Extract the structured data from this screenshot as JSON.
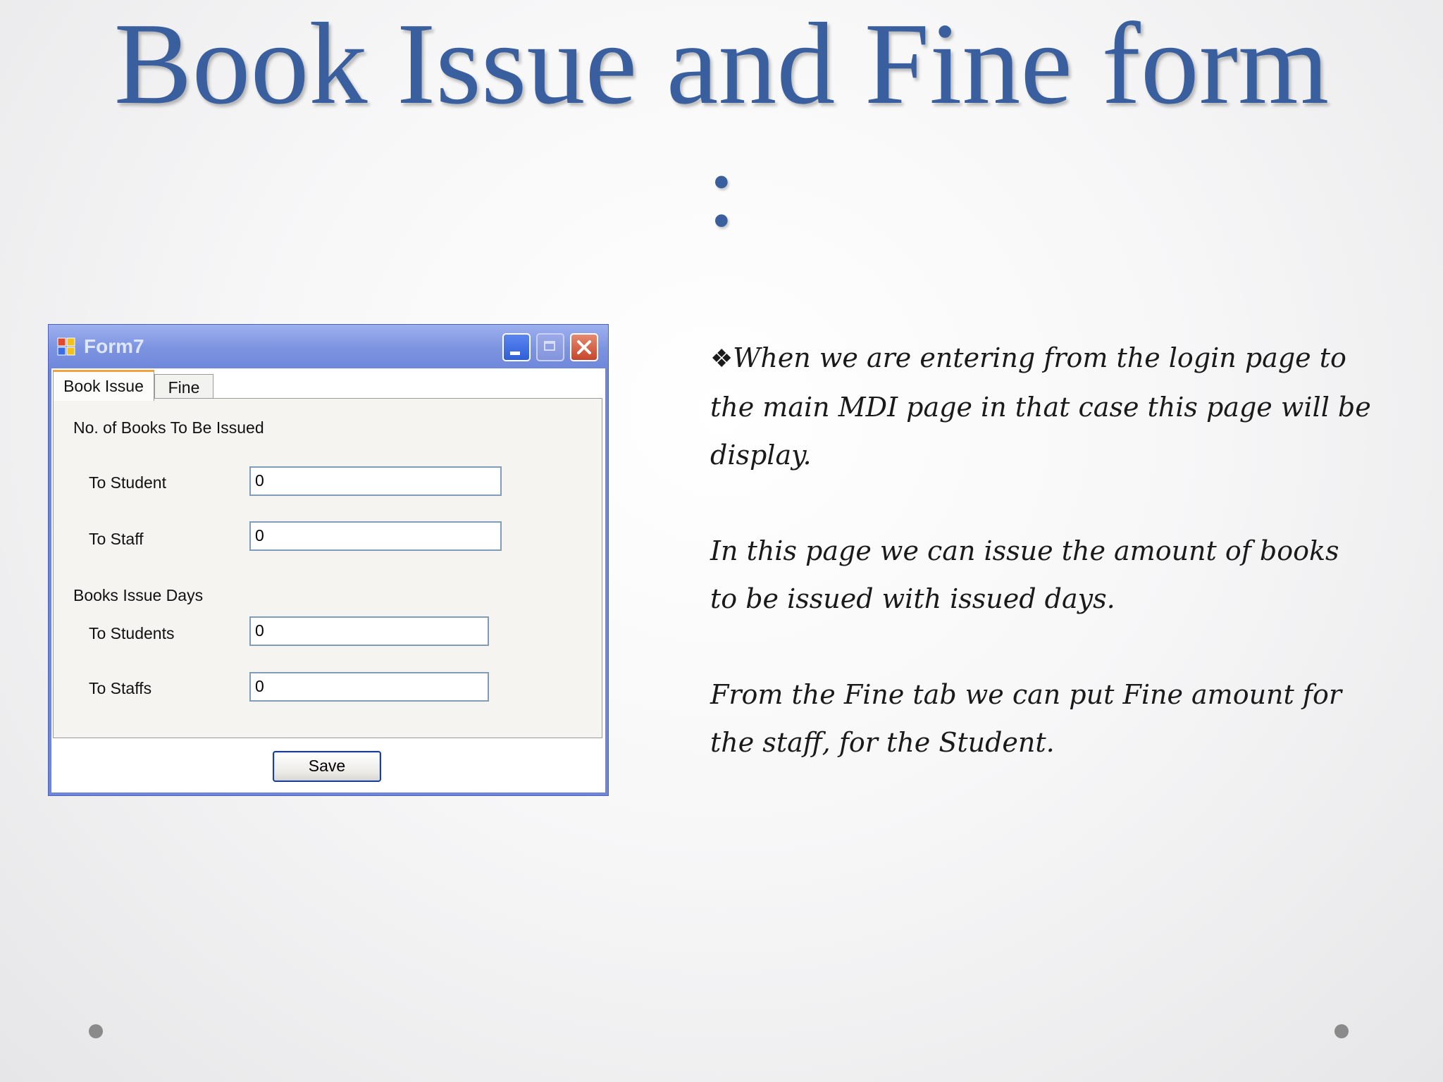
{
  "slide": {
    "title": "Book Issue and Fine form",
    "colon": ":"
  },
  "window": {
    "title": "Form7",
    "tabs": [
      {
        "label": "Book Issue",
        "selected": true
      },
      {
        "label": "Fine",
        "selected": false
      }
    ],
    "section_books": {
      "heading": "No. of Books To Be Issued",
      "to_student_label": "To Student",
      "to_student_value": "0",
      "to_staff_label": "To Staff",
      "to_staff_value": "0"
    },
    "section_days": {
      "heading": "Books Issue Days",
      "to_students_label": "To Students",
      "to_students_value": "0",
      "to_staffs_label": "To Staffs",
      "to_staffs_value": "0"
    },
    "save_label": "Save"
  },
  "description": {
    "bullet_icon": "❖",
    "para1": "When we are entering from the login page to the main MDI page in that case this page will be display.",
    "para2": "In this page we can issue the amount of books to be issued with issued days.",
    "para3": "From the Fine tab we can put Fine amount for the staff, for the Student."
  },
  "colors": {
    "title": "#3a5f9e",
    "titlebar": "#7c93e0",
    "field_border": "#7f9db9"
  }
}
